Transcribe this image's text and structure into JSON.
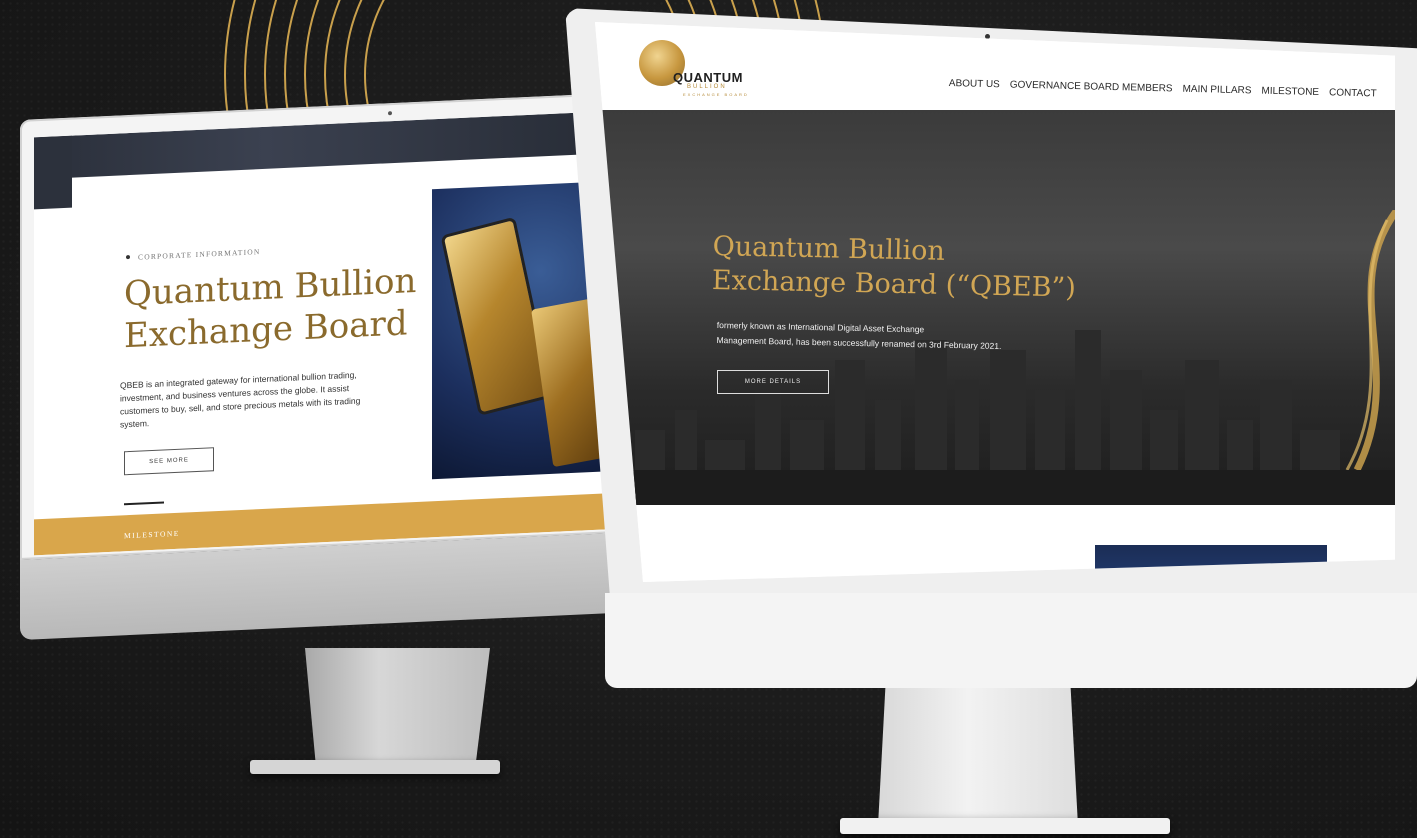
{
  "colors": {
    "gold": "#d1a654",
    "dark_gold": "#8a6a2d",
    "milestone_bar": "#d9a64b",
    "background": "#1b1b1b"
  },
  "back_screen": {
    "section_label": "CORPORATE INFORMATION",
    "title_line1": "Quantum Bullion",
    "title_line2": "Exchange Board",
    "description": "QBEB is an integrated gateway for international bullion trading, investment, and business ventures across the globe. It assist customers to buy, sell, and store precious metals with its trading system.",
    "button": "SEE MORE",
    "milestone_label": "MILESTONE"
  },
  "front_screen": {
    "logo": {
      "word": "QUANTUM",
      "sub": "BULLION",
      "sub2": "EXCHANGE BOARD"
    },
    "nav": [
      "ABOUT US",
      "GOVERNANCE BOARD MEMBERS",
      "MAIN PILLARS",
      "MILESTONE",
      "CONTACT"
    ],
    "hero": {
      "title_line1": "Quantum Bullion",
      "title_line2": "Exchange Board (“QBEB”)",
      "description_line1": "formerly known as International Digital Asset Exchange",
      "description_line2": "Management Board, has been successfully renamed on 3rd February 2021.",
      "button": "MORE DETAILS"
    }
  }
}
